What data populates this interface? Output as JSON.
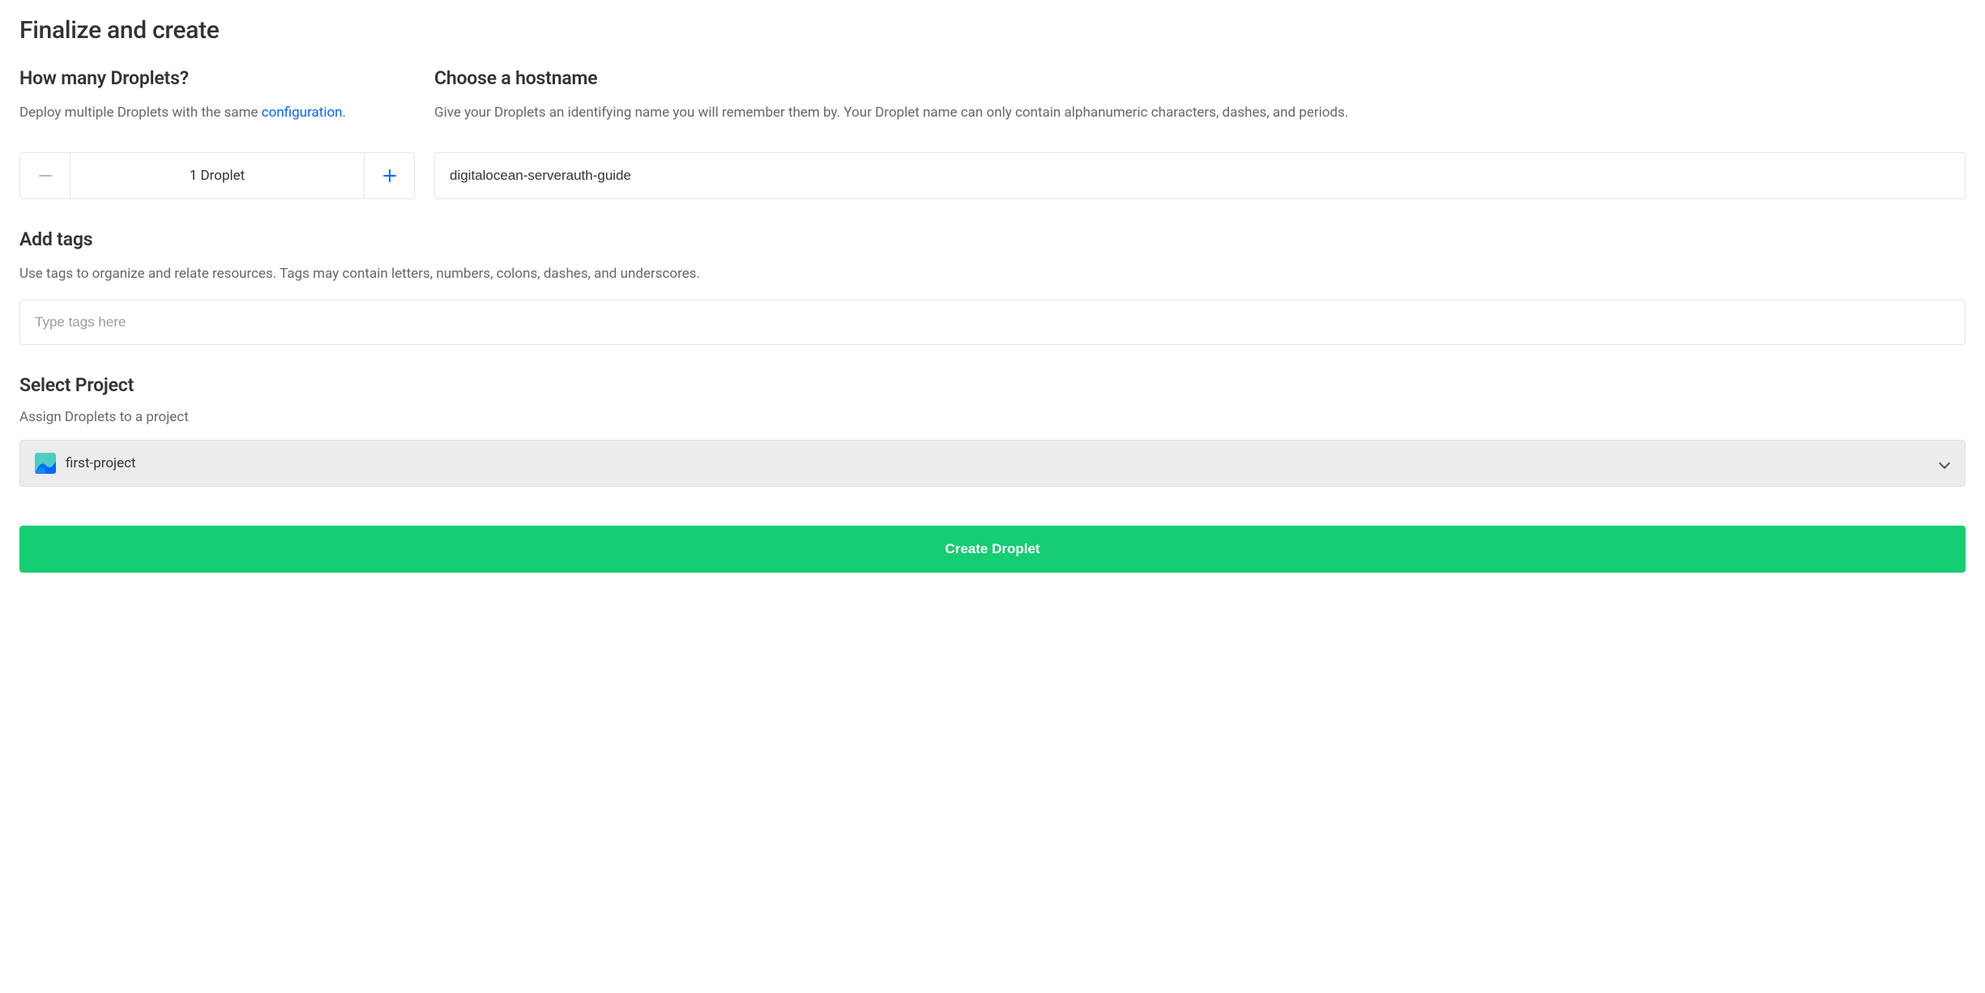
{
  "page_title": "Finalize and create",
  "droplets": {
    "heading": "How many Droplets?",
    "desc_prefix": "Deploy multiple Droplets with the same ",
    "desc_link": "configuration",
    "desc_suffix": ".",
    "count_label": "1 Droplet"
  },
  "hostname": {
    "heading": "Choose a hostname",
    "desc": "Give your Droplets an identifying name you will remember them by. Your Droplet name can only contain alphanumeric characters, dashes, and periods.",
    "value": "digitalocean-serverauth-guide"
  },
  "tags": {
    "heading": "Add tags",
    "desc": "Use tags to organize and relate resources. Tags may contain letters, numbers, colons, dashes, and underscores.",
    "placeholder": "Type tags here"
  },
  "project": {
    "heading": "Select Project",
    "desc": "Assign Droplets to a project",
    "selected": "first-project"
  },
  "create_button": "Create Droplet"
}
